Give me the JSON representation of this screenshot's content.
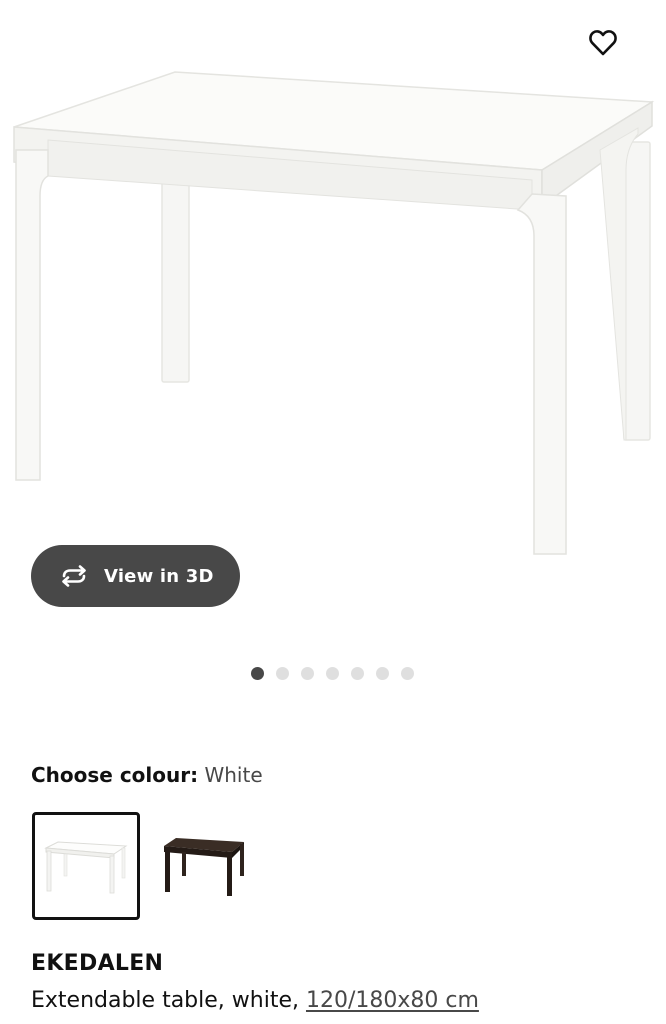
{
  "product_image": {
    "alt": "EKEDALEN extendable table, white",
    "gallery_index": 1,
    "gallery_count": 7
  },
  "favourite": {
    "icon": "heart-outline-icon"
  },
  "view_3d": {
    "label": "View in 3D",
    "icon": "rotate-arrows-icon"
  },
  "colour_selector": {
    "label": "Choose colour:",
    "selected_value": "White",
    "options": [
      {
        "name": "White",
        "color": "#ffffff",
        "selected": true
      },
      {
        "name": "Dark brown",
        "color": "#2b211b",
        "selected": false
      }
    ]
  },
  "product": {
    "name": "EKEDALEN",
    "description_prefix": "Extendable table, white, ",
    "size_link": "120/180x80 cm"
  },
  "colors": {
    "dark_button": "#484848",
    "active_dot": "#484848",
    "inactive_dot": "#dfdfdf",
    "text": "#111111"
  }
}
